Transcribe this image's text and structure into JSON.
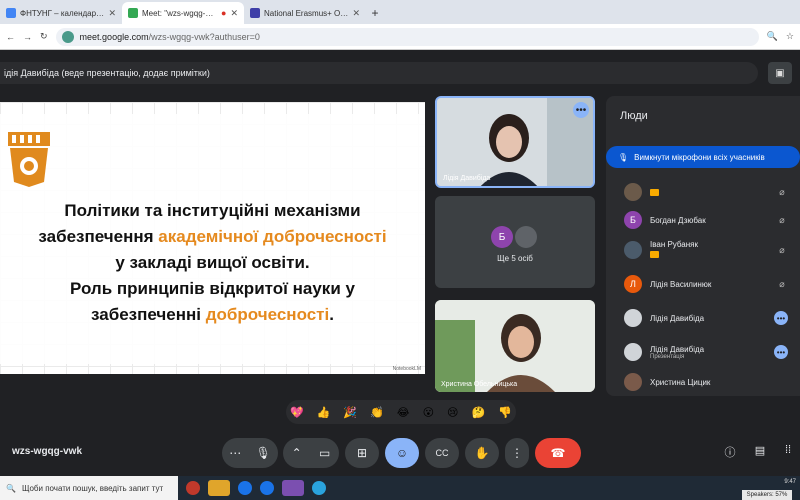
{
  "browser": {
    "tabs": [
      {
        "label": "ФНТУНГ – календар - 4 дні, п",
        "active": false
      },
      {
        "label": "Meet: \"wzs-wgqg-vwk\"",
        "active": true
      },
      {
        "label": "National Erasmus+ Office in Uk",
        "active": false
      }
    ],
    "url_domain": "meet.google.com",
    "url_path": "/wzs-wgqg-vwk?authuser=0"
  },
  "meet": {
    "presenting_banner": "ідія Давибіда (веде презентацію, додає примітки)",
    "slide": {
      "line1": "Політики та інституційні механізми",
      "line2_pre": "забезпечення ",
      "line2_hl": "академічної доброчесності",
      "line3": "у закладі вищої освіти.",
      "line4": "Роль принципів відкритої науки у",
      "line5_pre": "забезпеченні ",
      "line5_hl": "доброчесності",
      "line5_post": ".",
      "footer": "NotebookLM"
    },
    "tiles": {
      "tile1_name": "Лідія Давибіда",
      "others_initial": "Б",
      "others_label": "Ще 5 осіб",
      "tile3_name": "Христина Обельницька"
    },
    "people": {
      "title": "Люди",
      "mute_all": "Вимкнути мікрофони всіх учасників",
      "list": [
        {
          "initial": "",
          "name": "",
          "sub": "",
          "color": "#6b5a4a"
        },
        {
          "initial": "Б",
          "name": "Богдан Дзюбак",
          "sub": "",
          "color": "#8e44ad"
        },
        {
          "initial": "",
          "name": "Іван Рубаняк",
          "sub": "",
          "color": "#4b5b6b"
        },
        {
          "initial": "Л",
          "name": "Лідія Василинюк",
          "sub": "",
          "color": "#e8590c"
        },
        {
          "initial": "",
          "name": "Лідія Давибіда",
          "sub": "",
          "color": "#d0d4d8"
        },
        {
          "initial": "",
          "name": "Лідія Давибіда",
          "sub": "Презентація",
          "color": "#d0d4d8"
        },
        {
          "initial": "",
          "name": "Христина Цицик",
          "sub": "",
          "color": "#7a5a4a"
        }
      ]
    },
    "reactions": [
      "💖",
      "👍",
      "🎉",
      "👏",
      "😂",
      "😮",
      "😢",
      "🤔",
      "👎"
    ],
    "meeting_code": "wzs-wgqg-vwk"
  },
  "taskbar": {
    "search_placeholder": "Щоби почати пошук, введіть запит тут",
    "time": "9:47",
    "speakers": "Speakers: 57%"
  }
}
